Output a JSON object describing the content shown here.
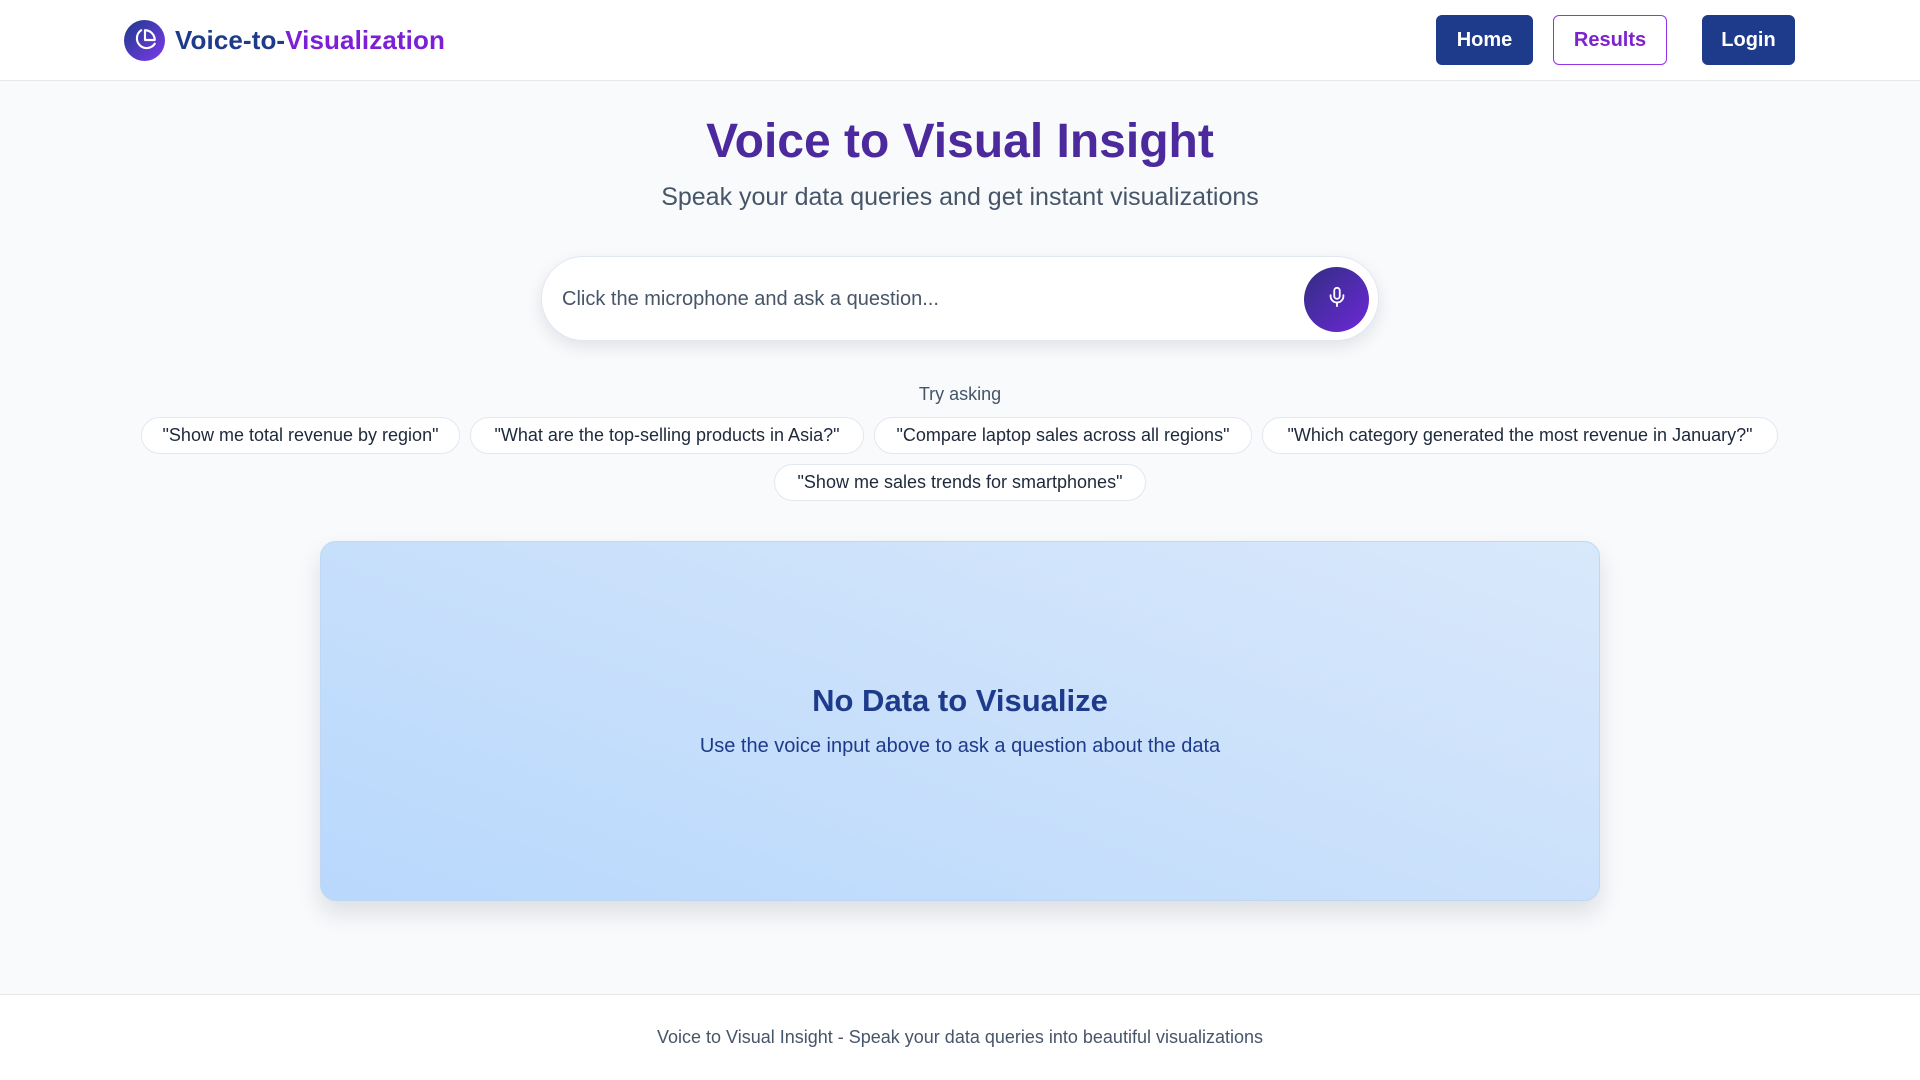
{
  "brand": {
    "name_part1": "Voice-to-",
    "name_part2": "Visualization",
    "logo_icon": "pie-chart-icon"
  },
  "nav": {
    "home": "Home",
    "results": "Results",
    "login": "Login"
  },
  "hero": {
    "title": "Voice to Visual Insight",
    "subtitle": "Speak your data queries and get instant visualizations"
  },
  "voice": {
    "placeholder": "Click the microphone and ask a question...",
    "mic_icon": "microphone-icon"
  },
  "suggestions": {
    "label": "Try asking",
    "items": [
      "\"Show me total revenue by region\"",
      "\"What are the top-selling products in Asia?\"",
      "\"Compare laptop sales across all regions\"",
      "\"Which category generated the most revenue in January?\"",
      "\"Show me sales trends for smartphones\""
    ]
  },
  "visualization": {
    "empty_title": "No Data to Visualize",
    "empty_message": "Use the voice input above to ask a question about the data"
  },
  "footer": {
    "text": "Voice to Visual Insight - Speak your data queries into beautiful visualizations"
  },
  "colors": {
    "primary": "#1e3a8a",
    "accent": "#7c3aed",
    "title": "#4c2a9e",
    "panel": "#c9e0fb"
  }
}
